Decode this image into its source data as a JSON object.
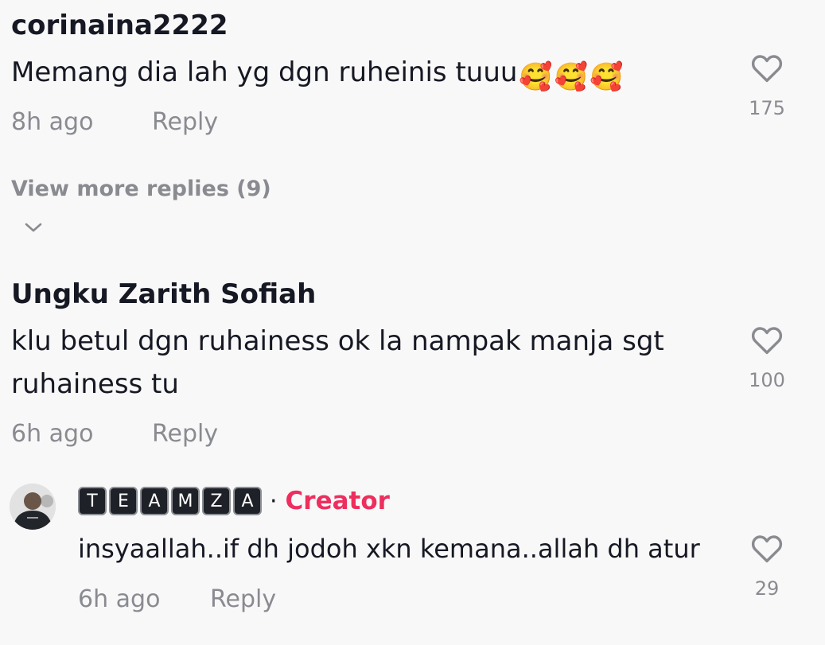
{
  "comments": [
    {
      "username": "corinaina2222",
      "text": "Memang dia lah yg dgn ruheinis tuuu",
      "emojis": [
        "🥰",
        "🥰",
        "🥰"
      ],
      "time": "8h ago",
      "reply_label": "Reply",
      "likes": "175",
      "view_more_label": "View more replies (9)"
    },
    {
      "username": "Ungku Zarith Sofiah",
      "text": "klu betul dgn ruhainess ok la nampak manja sgt ruhainess tu",
      "time": "6h ago",
      "reply_label": "Reply",
      "likes": "100",
      "replies": [
        {
          "username_letters": [
            "T",
            "E",
            "A",
            "M",
            "Z",
            "A"
          ],
          "separator": "·",
          "badge": "Creator",
          "text": "insyaallah..if dh jodoh xkn kemana..allah dh atur",
          "time": "6h ago",
          "reply_label": "Reply",
          "likes": "29"
        }
      ]
    }
  ],
  "icons": {
    "like": "heart-outline-icon",
    "expand": "chevron-down-icon"
  },
  "colors": {
    "background": "#f8f8f8",
    "primary_text": "#161823",
    "secondary_text": "#8a8b91",
    "creator_badge": "#ee2e5e"
  }
}
